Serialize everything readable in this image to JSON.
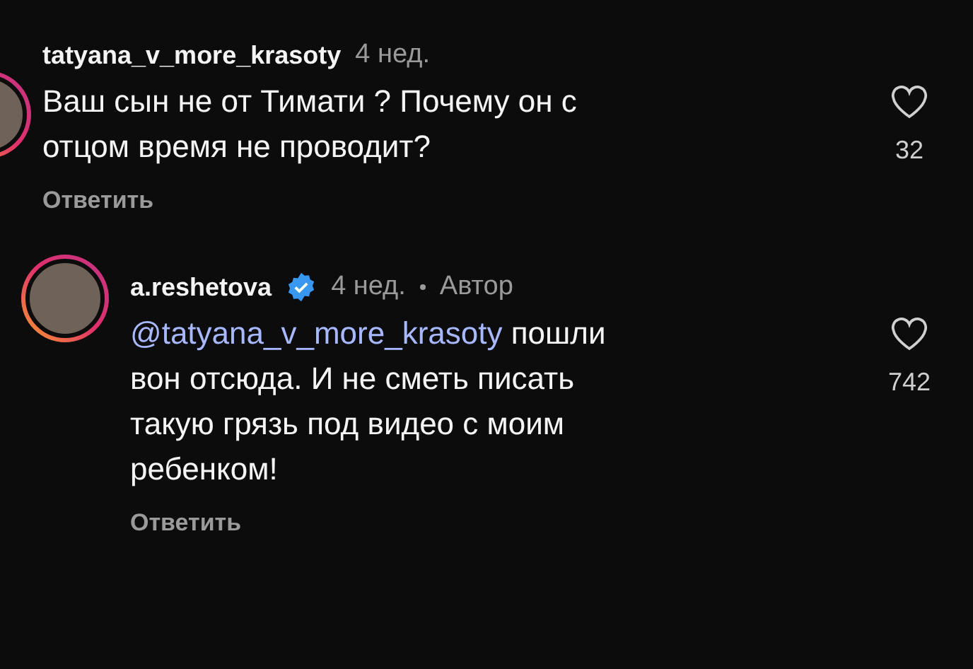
{
  "comments": [
    {
      "kind": "cropped",
      "username": "tatyana_v_more_krasoty",
      "verified": false,
      "time": "4 нед.",
      "text": "Ваш сын не от Тимати ?  Почему он с\nотцом время не проводит?",
      "likes": "32",
      "reply": "Ответить"
    },
    {
      "kind": "full",
      "username": "a.reshetova",
      "verified": true,
      "time": "4 нед.",
      "author_label": "Автор",
      "mention": "@tatyana_v_more_krasoty",
      "text": " пошли\nвон отсюда. И не сметь писать\nтакую грязь под видео с моим\nребенком!",
      "likes": "742",
      "reply": "Ответить"
    }
  ]
}
